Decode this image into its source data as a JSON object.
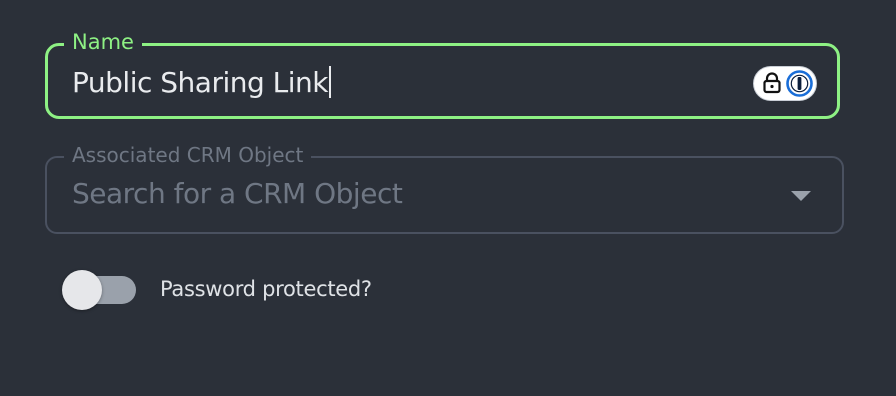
{
  "name_field": {
    "label": "Name",
    "value": "Public Sharing Link",
    "focused": true,
    "accent_color": "#8ef184"
  },
  "password_manager": {
    "lock_icon": "lock-icon",
    "logo_icon": "1password-icon"
  },
  "crm_field": {
    "label": "Associated CRM Object",
    "placeholder": "Search for a CRM Object",
    "disabled": true
  },
  "password_toggle": {
    "label": "Password protected?",
    "checked": false
  }
}
